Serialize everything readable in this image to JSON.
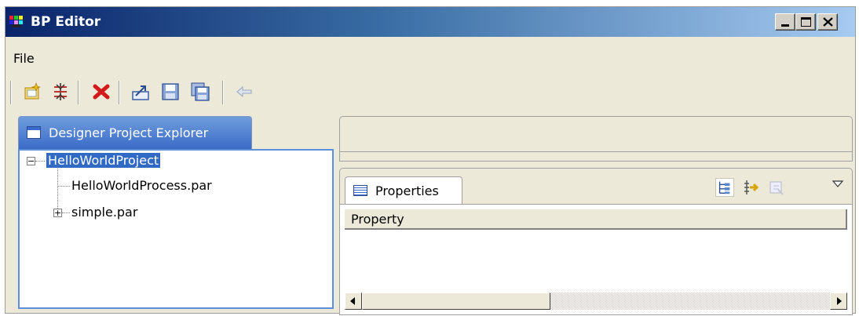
{
  "window": {
    "title": "BP Editor"
  },
  "menubar": {
    "items": [
      "File"
    ]
  },
  "toolbar": {
    "buttons": [
      "new-project-icon",
      "deploy-icon",
      "delete-icon",
      "export-icon",
      "save-icon",
      "save-all-icon",
      "back-icon"
    ]
  },
  "explorer": {
    "tab_label": "Designer Project Explorer",
    "tree": {
      "root": "HelloWorldProject",
      "children": [
        {
          "label": "HelloWorldProcess.par",
          "expandable": false
        },
        {
          "label": "simple.par",
          "expandable": true
        }
      ]
    }
  },
  "properties": {
    "tab_label": "Properties",
    "column_header": "Property",
    "toolbar": [
      "show-categories-icon",
      "show-advanced-icon",
      "restore-default-icon",
      "view-menu-icon"
    ]
  }
}
